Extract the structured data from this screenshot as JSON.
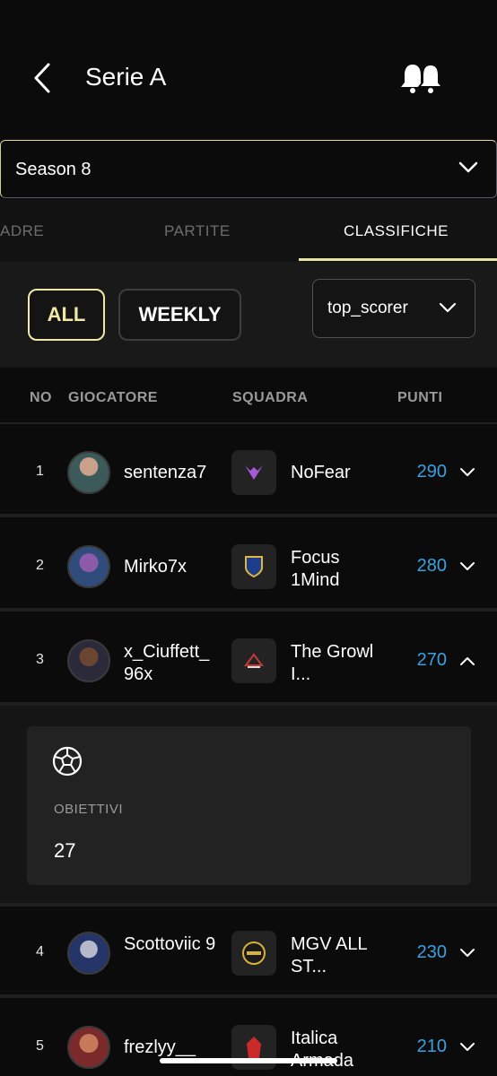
{
  "header": {
    "title": "Serie A"
  },
  "season": {
    "selected": "Season 8"
  },
  "tabs": [
    {
      "label": "ADRE",
      "active": false
    },
    {
      "label": "PARTITE",
      "active": false
    },
    {
      "label": "CLASSIFICHE",
      "active": true
    }
  ],
  "filters": {
    "all_label": "ALL",
    "weekly_label": "WEEKLY",
    "metric": "top_scorer"
  },
  "table": {
    "columns": {
      "no": "NO",
      "player": "GIOCATORE",
      "team": "SQUADRA",
      "points": "PUNTI"
    },
    "rows": [
      {
        "rank": "1",
        "player": "sentenza7",
        "team": "NoFear",
        "points": "290",
        "expanded": false
      },
      {
        "rank": "2",
        "player": "Mirko7x",
        "team": "Focus 1Mind",
        "points": "280",
        "expanded": false
      },
      {
        "rank": "3",
        "player": "x_Ciuffett_ 96x",
        "team": "The Growl I...",
        "points": "270",
        "expanded": true
      },
      {
        "rank": "4",
        "player": "Scottoviic 9",
        "team": "MGV ALL ST...",
        "points": "230",
        "expanded": false
      },
      {
        "rank": "5",
        "player": "frezlyy__",
        "team": "Italica Armada",
        "points": "210",
        "expanded": false
      }
    ]
  },
  "expanded_stat": {
    "label": "OBIETTIVI",
    "value": "27"
  },
  "colors": {
    "accent": "#efe8a6",
    "points": "#3aa0e2",
    "background": "#0b0b0b"
  }
}
